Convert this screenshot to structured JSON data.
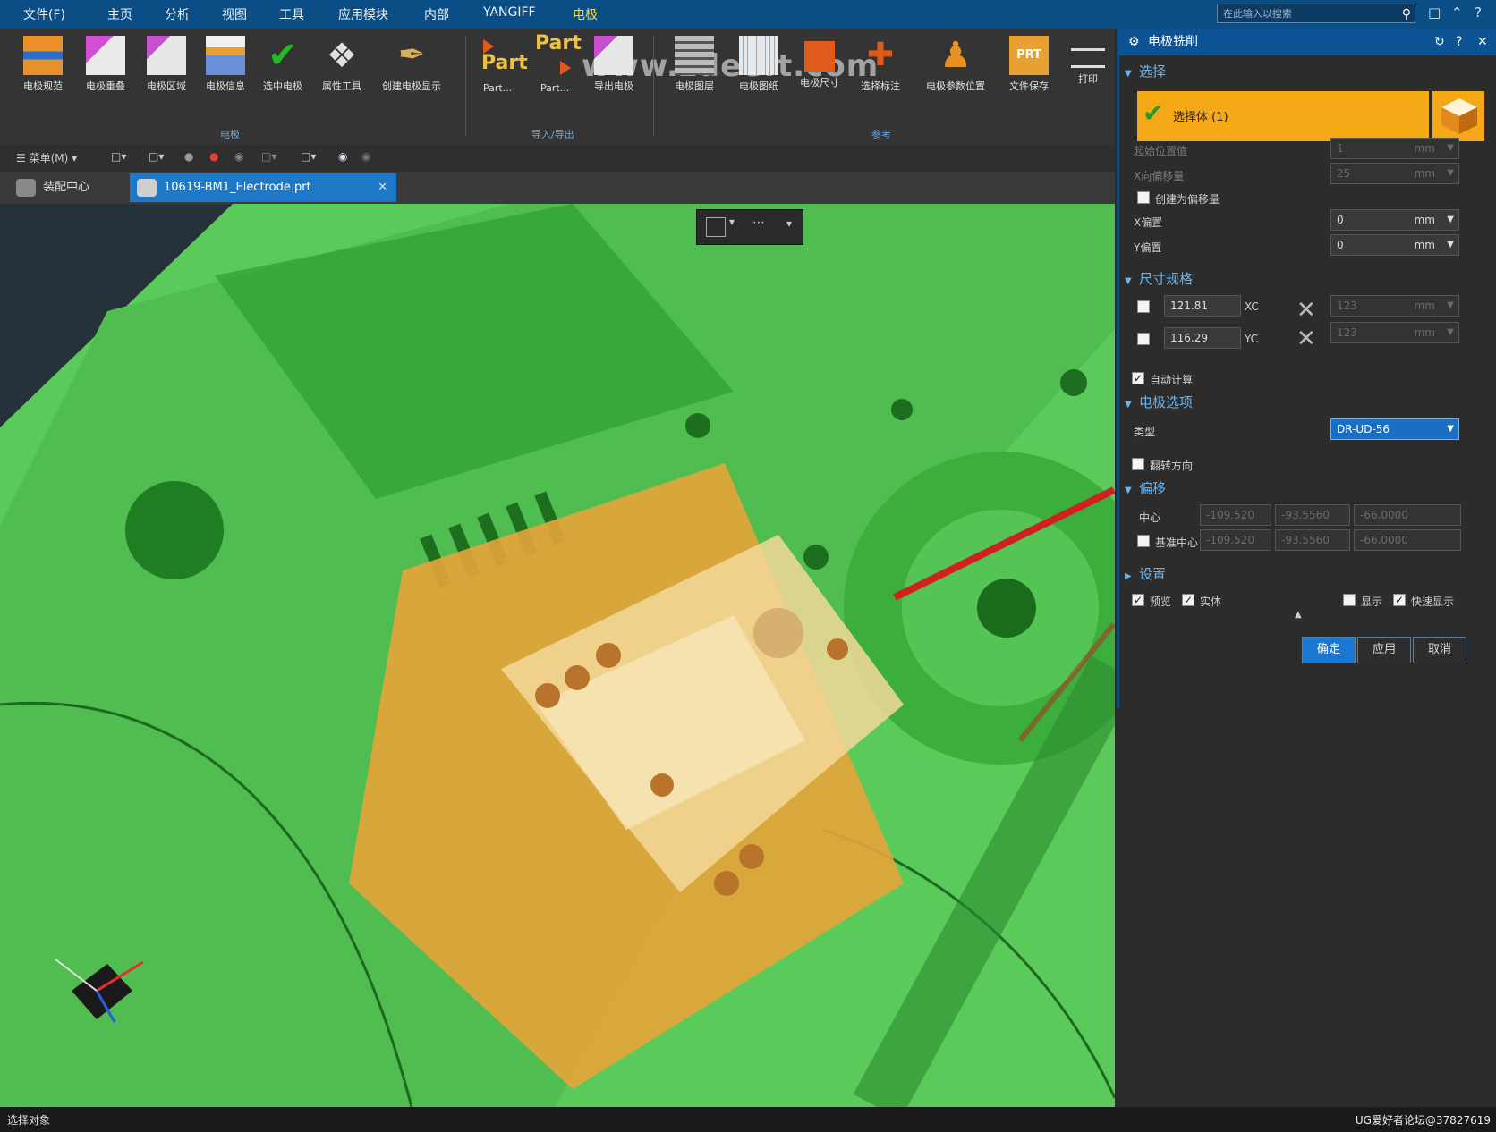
{
  "menu": {
    "items": [
      "文件(F)",
      "主页",
      "分析",
      "视图",
      "工具",
      "应用模块",
      "内部",
      "YANGIFF",
      "电极"
    ],
    "active": "电极",
    "search_placeholder": "在此输入以搜索"
  },
  "ribbon": {
    "buttons": [
      "电极规范",
      "电极重叠",
      "电极区域",
      "电极信息",
      "选中电极",
      "属性工具",
      "创建电极显示"
    ],
    "part_labels": [
      "Part",
      "Part"
    ],
    "part_sub": [
      "Part...",
      "Part..."
    ],
    "buttons2": [
      "导出电极",
      "电极图层",
      "电极图纸",
      "电极尺寸",
      "选择标注",
      "电极参数位置",
      "文件保存",
      "打印"
    ],
    "groups": [
      "电极",
      "导入/导出",
      "参考"
    ],
    "watermark": "www.zdeeft.com"
  },
  "quickbar": {
    "menu_label": "菜单(M)"
  },
  "tabs": {
    "home": "装配中心",
    "file": "10619-BM1_Electrode.prt"
  },
  "panel": {
    "title": "电极铣削",
    "sections": {
      "select": "选择",
      "size": "尺寸规格",
      "electrode": "电极选项",
      "offset": "偏移",
      "settings": "设置"
    },
    "selected_text": "选择体 (1)",
    "rows": {
      "start_pos": "起始位置值",
      "pos_offset": "X向偏移量",
      "use_default": "创建为偏移量",
      "x_offset": "X偏置",
      "y_offset": "Y偏置"
    },
    "values": {
      "start_pos": "1",
      "pos_offset": "25",
      "x_offset": "0",
      "y_offset": "0",
      "unit": "mm",
      "size_x": "121.81",
      "size_y": "116.29",
      "xc_label": "XC",
      "yc_label": "YC",
      "dim_x": "123",
      "dim_y": "123"
    },
    "auto_size_label": "自动计算",
    "electrode_type_label": "类型",
    "electrode_type_value": "DR-UD-56",
    "flip_label": "翻转方向",
    "offset_rows": {
      "center": "中心",
      "base": "基准中心"
    },
    "offset_vals": {
      "center": [
        "-109.520",
        "-93.5560",
        "-66.0000"
      ],
      "base": [
        "-109.520",
        "-93.5560",
        "-66.0000"
      ]
    },
    "settings": {
      "opts": [
        "预览",
        "实体",
        "显示",
        "快速显示"
      ],
      "checked": [
        true,
        true,
        false,
        true
      ]
    },
    "buttons": {
      "ok": "确定",
      "apply": "应用",
      "cancel": "取消"
    }
  },
  "status": {
    "left": "选择对象",
    "footer": "UG爱好者论坛@37827619"
  },
  "colors": {
    "accent": "#0b4e86",
    "selection": "#f5a818",
    "model_green": "#5acb5a"
  }
}
